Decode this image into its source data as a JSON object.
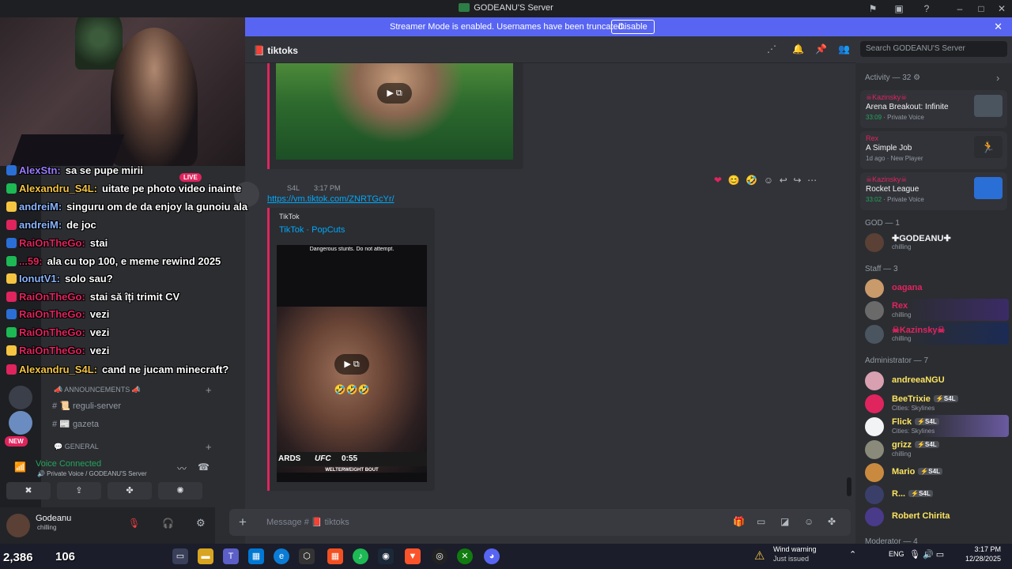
{
  "window": {
    "title": "GODEANU'S Server"
  },
  "banner": {
    "text": "Streamer Mode is enabled. Usernames have been truncated.",
    "button": "Disable"
  },
  "channel": {
    "name": "tiktoks",
    "search_placeholder": "Search GODEANU'S Server"
  },
  "message": {
    "author": "S4L",
    "time": "3:17 PM",
    "link": "https://vm.tiktok.com/ZNRTGcYr/",
    "embed_provider": "TikTok",
    "embed_title": "TikTok · PopCuts",
    "video_caption": "Dangerous stunts. Do not attempt.",
    "video_emojis": "🤣🤣🤣",
    "ufc_left": "ARDS",
    "ufc_logo": "UFC",
    "ufc_time": "0:55",
    "ufc_sub": "WELTERWEIGHT BOUT"
  },
  "composer": {
    "placeholder": "Message # 📕 tiktoks"
  },
  "members": {
    "activity_header": "Activity — 32",
    "activities": [
      {
        "name": "☠Kazinsky☠",
        "game": "Arena Breakout: Infinite",
        "time": "33:09",
        "meta": "Private Voice",
        "color": "#4a5560"
      },
      {
        "name": "Rex",
        "game": "A Simple Job",
        "time": "1d ago",
        "meta": "New Player",
        "color": "#e6e6e6"
      },
      {
        "name": "☠Kazinsky☠",
        "game": "Rocket League",
        "time": "33:02",
        "meta": "Private Voice",
        "color": "#2a6fd6"
      }
    ],
    "god_header": "GOD — 1",
    "god": [
      {
        "name": "✚GODEANU✚",
        "status": "chilling",
        "color": "#f2f3f5"
      }
    ],
    "staff_header": "Staff — 3",
    "staff": [
      {
        "name": "oagana",
        "status": "",
        "color": "#e0245e"
      },
      {
        "name": "Rex",
        "status": "chilling",
        "color": "#e0245e"
      },
      {
        "name": "☠Kazinsky☠",
        "status": "chilling",
        "color": "#e0245e"
      }
    ],
    "admin_header": "Administrator — 7",
    "admins": [
      {
        "name": "andreeaNGU",
        "status": "",
        "tag": "",
        "color": "#fce45f"
      },
      {
        "name": "BeeTrixie",
        "status": "Cities: Skylines",
        "tag": "⚡S4L",
        "color": "#fce45f"
      },
      {
        "name": "Flick",
        "status": "Cities: Skylines",
        "tag": "⚡S4L",
        "color": "#fce45f"
      },
      {
        "name": "grizz",
        "status": "chilling",
        "tag": "⚡S4L",
        "color": "#fce45f"
      },
      {
        "name": "Mario",
        "status": "",
        "tag": "⚡S4L",
        "color": "#fce45f"
      },
      {
        "name": "R...",
        "status": "",
        "tag": "⚡S4L",
        "color": "#fce45f"
      },
      {
        "name": "Robert Chirita",
        "status": "",
        "tag": "",
        "color": "#fce45f"
      }
    ],
    "moderator_header": "Moderator — 4"
  },
  "sidebar": {
    "channels": [
      {
        "label": "reguli-server"
      },
      {
        "label": "gazeta"
      }
    ],
    "cat_announcements": "📣 ANNOUNCEMENTS 📣",
    "cat_general": "💬 GENERAL",
    "voice_title": "Voice Connected",
    "voice_sub": "🔊 Private Voice / GODEANU'S Server",
    "user_name": "Godeanu",
    "user_status": "chilling"
  },
  "chat_overlay": [
    {
      "name": "AlexStn:",
      "msg": "sa se pupe mirii",
      "color": "#9b7bff"
    },
    {
      "name": "Alexandru_S4L:",
      "msg": "uitate pe photo video inainte",
      "color": "#f5c542"
    },
    {
      "name": "andreiM:",
      "msg": "singuru om de da enjoy la gunoiu ala",
      "color": "#8ab4ff"
    },
    {
      "name": "andreiM:",
      "msg": "de joc",
      "color": "#8ab4ff"
    },
    {
      "name": "RaiOnTheGo:",
      "msg": "stai",
      "color": "#e0245e"
    },
    {
      "name": "...59:",
      "msg": "ala cu top 100, e meme rewind 2025",
      "color": "#e0245e"
    },
    {
      "name": "IonutV1:",
      "msg": "solo sau?",
      "color": "#8ab4ff"
    },
    {
      "name": "RaiOnTheGo:",
      "msg": "stai să îți trimit CV",
      "color": "#e0245e"
    },
    {
      "name": "RaiOnTheGo:",
      "msg": "vezi",
      "color": "#e0245e"
    },
    {
      "name": "RaiOnTheGo:",
      "msg": "vezi",
      "color": "#e0245e"
    },
    {
      "name": "RaiOnTheGo:",
      "msg": "vezi",
      "color": "#e0245e"
    },
    {
      "name": "Alexandru_S4L:",
      "msg": "cand ne jucam minecraft?",
      "color": "#f5c542"
    }
  ],
  "stream": {
    "live": "LIVE",
    "viewers": "2,386",
    "followers": "106"
  },
  "taskbar": {
    "weather_title": "Wind warning",
    "weather_sub": "Just issued",
    "lang": "ENG",
    "time": "3:17 PM",
    "date": "12/28/2025"
  }
}
